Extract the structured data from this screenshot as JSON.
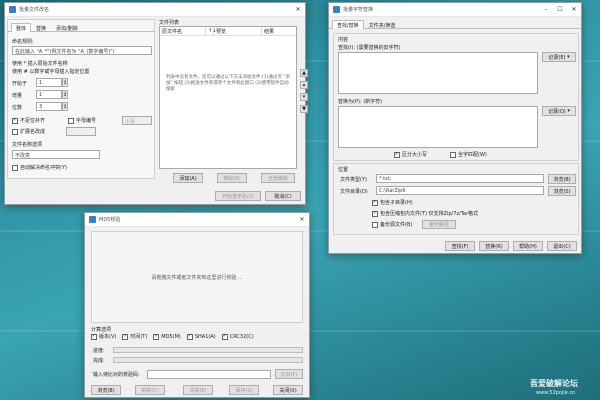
{
  "win1": {
    "title": "批量文件改名",
    "tabs": [
      "整体",
      "替换",
      "添加/删除"
    ],
    "rename_rule_label": "命名规则:",
    "rename_rule_placeholder": "在此输入 \"A_*\"(例文件名为 \"A_(数字编号)\")",
    "hint1": "使用 * 插入原始文件名称",
    "hint2": "使用 # 以数字或字母插入指定位置",
    "start_label": "开始于",
    "start_value": "1",
    "step_label": "增量",
    "step_value": "1",
    "digits_label": "位数",
    "digits_value": "3",
    "cb_padzero": "不足位补齐",
    "cb_letter": "字母编号",
    "case_select": "小写",
    "cb_ext": "扩展名改成",
    "case_rule_label": "文件名称选项",
    "case_rule_value": "不改变",
    "cb_autoresolve": "自动解决命名冲突(Y)",
    "list_title": "文件列表",
    "col_orig": "原文件名",
    "col_preview": "预览",
    "col_result": "结果",
    "list_hint": "列表中没有文件。您可以通过以下方法添加文件:(1)通过点 \"添加\" 按钮 (2)拖放文件夹或单个文件到此窗口 (3)使用软件自动搜索",
    "btn_add": "添加(A)",
    "btn_remove": "移除(R)",
    "btn_clear": "全部移除",
    "btn_start": "开始重命名(S)",
    "btn_cancel": "取消(C)"
  },
  "win2": {
    "title": "批量字符替换",
    "tabs": [
      "查找/替换",
      "文件夹/筛选"
    ],
    "content_group": "内容",
    "find_label": "查找(I): (需要替换的旧字符)",
    "replace_label": "替换为(P): (新字符)",
    "record_btn": "记录(E)",
    "record_btn2": "记录(O)",
    "cb_case": "区分大小写",
    "cb_whole": "全字匹配(W)",
    "pos_group": "位置",
    "filetype_label": "文件类型(Y)",
    "filetype_value": "*.txt;",
    "dir_label": "文件目录(D)",
    "dir_value": "C:\\RarZip6",
    "browse": "浏览(B)",
    "browse2": "浏览(S)",
    "cb_subdir": "包含子目录(H)",
    "cb_archive": "包含压缩包内文件(T) 仅支持Zip/7z/Tar格式",
    "cb_backup": "备份源文件(B)",
    "backup_btn": "备份路径",
    "btn_find": "查找(F)",
    "btn_replace": "替换(R)",
    "btn_help": "帮助(H)",
    "btn_exit": "退出(C)"
  },
  "win3": {
    "title": "MD5校验",
    "drop_hint": "请拖拽文件或者文件夹到这里进行校验 ...",
    "calc_group": "计算选项",
    "opt_version": "版本(V)",
    "opt_time": "时间(T)",
    "opt_md5": "MD5(M)",
    "opt_sha1": "SHA1(A)",
    "opt_crc32": "CRC32(C)",
    "progress_label": "进度:",
    "done_label": "完成:",
    "compare_label": "输入待比对的校验码:",
    "compare_btn": "比对(F)",
    "btn_browse": "浏览(B)",
    "btn_copy": "复制(C)",
    "btn_clear": "清除(E)",
    "btn_save": "保存(S)",
    "btn_close": "关闭(X)"
  },
  "watermark": {
    "line1": "吾爱破解论坛",
    "line2": "www.52pojie.cn"
  }
}
